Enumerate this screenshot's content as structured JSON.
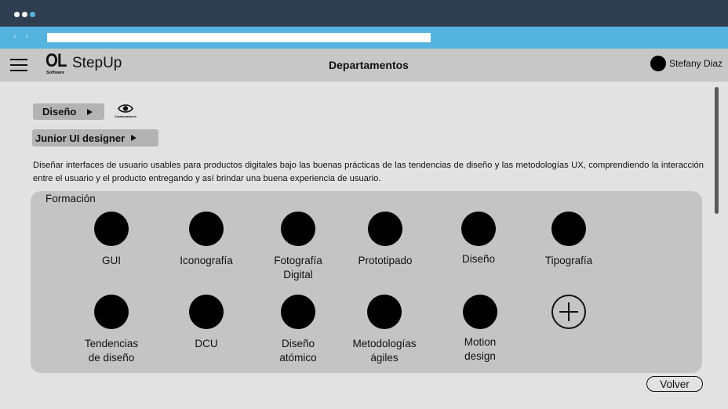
{
  "browser": {
    "back_glyph": "‹",
    "forward_glyph": "›",
    "url": ""
  },
  "header": {
    "logo_mark": "OL",
    "logo_sub": "Software",
    "logo_name": "StepUp",
    "title": "Departamentos",
    "user_name": "Stefany Diaz"
  },
  "breadcrumb": {
    "department": "Diseño",
    "role": "Junior UI designer",
    "collaborators_label": "Colaboradores"
  },
  "description": "Diseñar interfaces de usuario usables para productos digitales bajo las buenas prácticas de las tendencias de diseño y las metodologías UX, comprendiendo la interacción entre el usuario y el producto entregando y así brindar una buena experiencia de usuario.",
  "formacion": {
    "title": "Formación",
    "skills": [
      {
        "label": "GUI"
      },
      {
        "label": "Iconografía"
      },
      {
        "label": "Fotografía Digital"
      },
      {
        "label": "Prototipado"
      },
      {
        "label": "Diseño"
      },
      {
        "label": "Tipografía"
      },
      {
        "label": "Tendencias de diseño"
      },
      {
        "label": "DCU"
      },
      {
        "label": "Diseño atómico"
      },
      {
        "label": "Metodologías ágiles"
      },
      {
        "label": "Motion design"
      }
    ]
  },
  "footer": {
    "back_label": "Volver"
  },
  "colors": {
    "titlebar": "#2f3d50",
    "addressbar": "#55b3e0",
    "appbar": "#c7c7c7",
    "background": "#e2e2e2",
    "panel": "#c4c4c4"
  }
}
